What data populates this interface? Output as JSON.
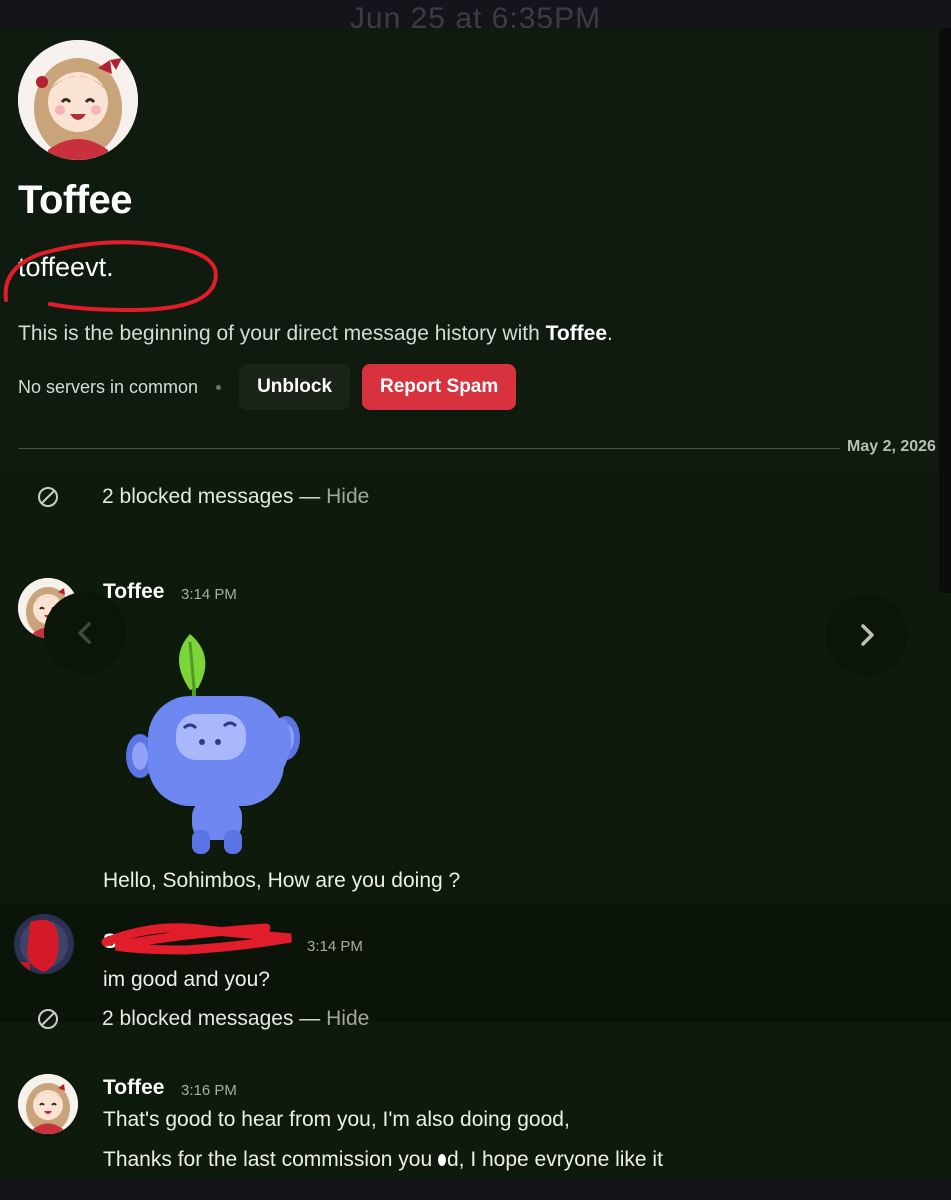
{
  "top_timestamp": "Jun 25 at 6:35PM",
  "profile": {
    "display_name": "Toffee",
    "username": "toffeevt.",
    "intro_prefix": "This is the beginning of your direct message history with ",
    "intro_name": "Toffee",
    "intro_suffix": ".",
    "servers_text": "No servers in common",
    "unblock_label": "Unblock",
    "report_label": "Report Spam"
  },
  "date_divider": "May 2, 2026",
  "blocked_1": {
    "text": "2 blocked messages — ",
    "hide": "Hide"
  },
  "message_1": {
    "author": "Toffee",
    "time": "3:14 PM",
    "sticker": "wumpus-waving-sticker",
    "text": "Hello, Sohimbos, How are you doing ?"
  },
  "message_2": {
    "author": "So",
    "time": "3:14 PM",
    "text": "im good and you?"
  },
  "blocked_2": {
    "text": "2 blocked messages — ",
    "hide": "Hide"
  },
  "message_3": {
    "author": "Toffee",
    "time": "3:16 PM",
    "line1": "That's good to hear from you, I'm also doing good,",
    "line2_a": "Thanks for the last commission you ",
    "line2_b": "d, I hope evryone like it"
  },
  "colors": {
    "background": "#0f1b0e",
    "danger": "#d8323f",
    "scribble": "#e21d2b"
  }
}
